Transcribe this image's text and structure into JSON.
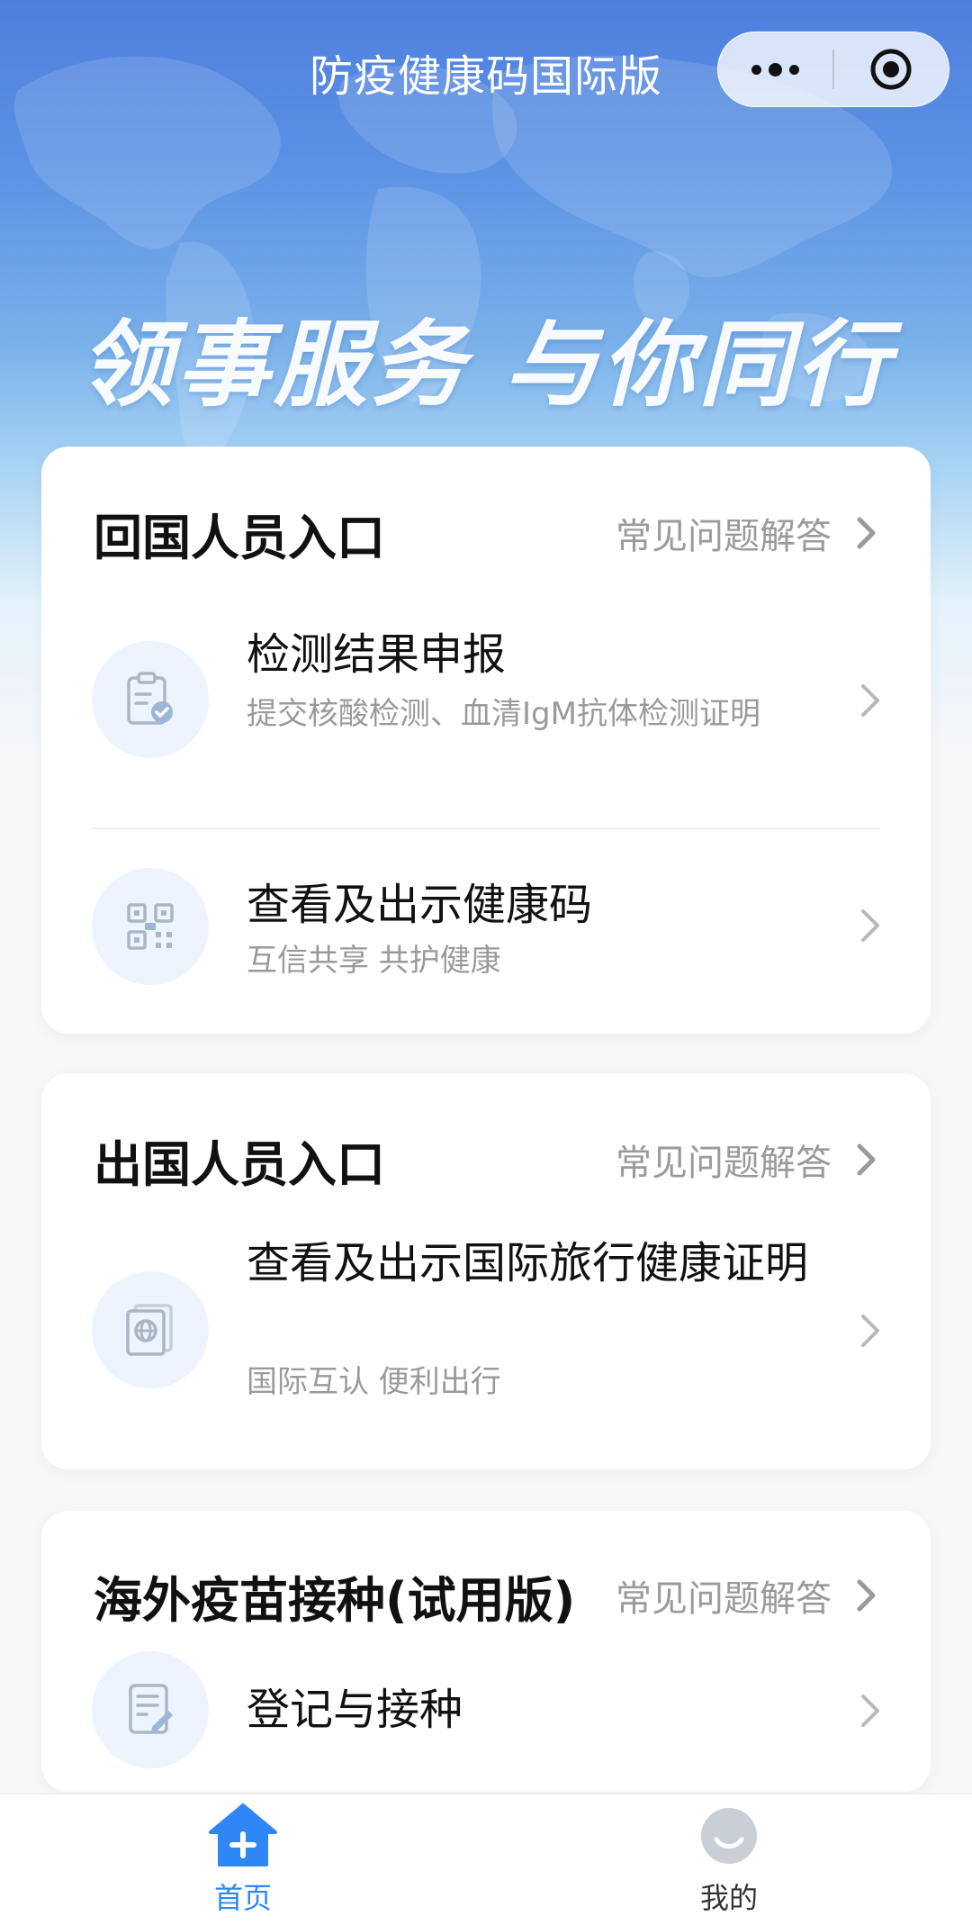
{
  "nav": {
    "title": "防疫健康码国际版"
  },
  "hero": {
    "slogan": "领事服务 与你同行"
  },
  "sections": [
    {
      "title": "回国人员入口",
      "faq_label": "常见问题解答",
      "items": [
        {
          "icon": "clipboard-check-icon",
          "title": "检测结果申报",
          "subtitle": "提交核酸检测、血清IgM抗体检测证明"
        },
        {
          "icon": "qr-code-icon",
          "title": "查看及出示健康码",
          "subtitle": "互信共享 共护健康"
        }
      ]
    },
    {
      "title": "出国人员入口",
      "faq_label": "常见问题解答",
      "items": [
        {
          "icon": "passport-globe-icon",
          "title": "查看及出示国际旅行健康证明",
          "subtitle": "国际互认 便利出行"
        }
      ]
    },
    {
      "title": "海外疫苗接种(试用版)",
      "faq_label": "常见问题解答",
      "items": [
        {
          "icon": "register-form-icon",
          "title": "登记与接种",
          "subtitle": ""
        }
      ]
    }
  ],
  "tabbar": {
    "items": [
      {
        "label": "首页",
        "icon": "home-plus-icon",
        "active": true
      },
      {
        "label": "我的",
        "icon": "avatar-icon",
        "active": false
      }
    ]
  },
  "colors": {
    "accent": "#2f86f6",
    "hero_top": "#4e7fde",
    "muted_text": "#9a9a9a",
    "icon_bg": "#edf4fd"
  }
}
